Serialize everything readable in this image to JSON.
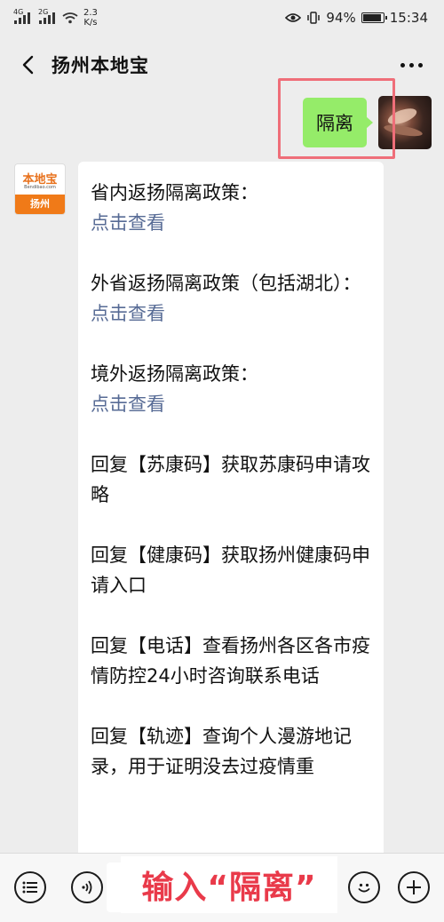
{
  "status_bar": {
    "signal1_tag": "4G",
    "signal2_tag": "2G",
    "speed_value": "2.3",
    "speed_unit": "K/s",
    "battery": "94%",
    "battery_level": 0.94,
    "time": "15:34"
  },
  "nav": {
    "title": "扬州本地宝"
  },
  "outgoing_message": {
    "text": "隔离"
  },
  "incoming_avatar": {
    "logo_text": "本地宝",
    "site_text": "Bendibao.com",
    "city_text": "扬州"
  },
  "incoming_message": {
    "p1_title": "省内返扬隔离政策：",
    "p1_link": "点击查看",
    "p2_title": "外省返扬隔离政策（包括湖北）：",
    "p2_link": "点击查看",
    "p3_title": "境外返扬隔离政策：",
    "p3_link": "点击查看",
    "p4": "回复【苏康码】获取苏康码申请攻略",
    "p5": "回复【健康码】获取扬州健康码申请入口",
    "p6": "回复【电话】查看扬州各区各市疫情防控24小时咨询联系电话",
    "p7": "回复【轨迹】查询个人漫游地记录，用于证明没去过疫情重"
  },
  "bottom_caption": "输入“隔离”",
  "colors": {
    "chat_background": "#ededed",
    "outgoing_bubble": "#95ec69",
    "link": "#576b95",
    "highlight_box": "#ef6e79",
    "caption_text": "#e93a4a",
    "logo_orange": "#f07a18"
  },
  "icons": [
    "back-arrow-icon",
    "more-icon",
    "menu-list-icon",
    "voice-icon",
    "emoji-icon",
    "plus-icon",
    "eye-icon",
    "vibrate-icon",
    "wifi-icon",
    "battery-icon"
  ]
}
